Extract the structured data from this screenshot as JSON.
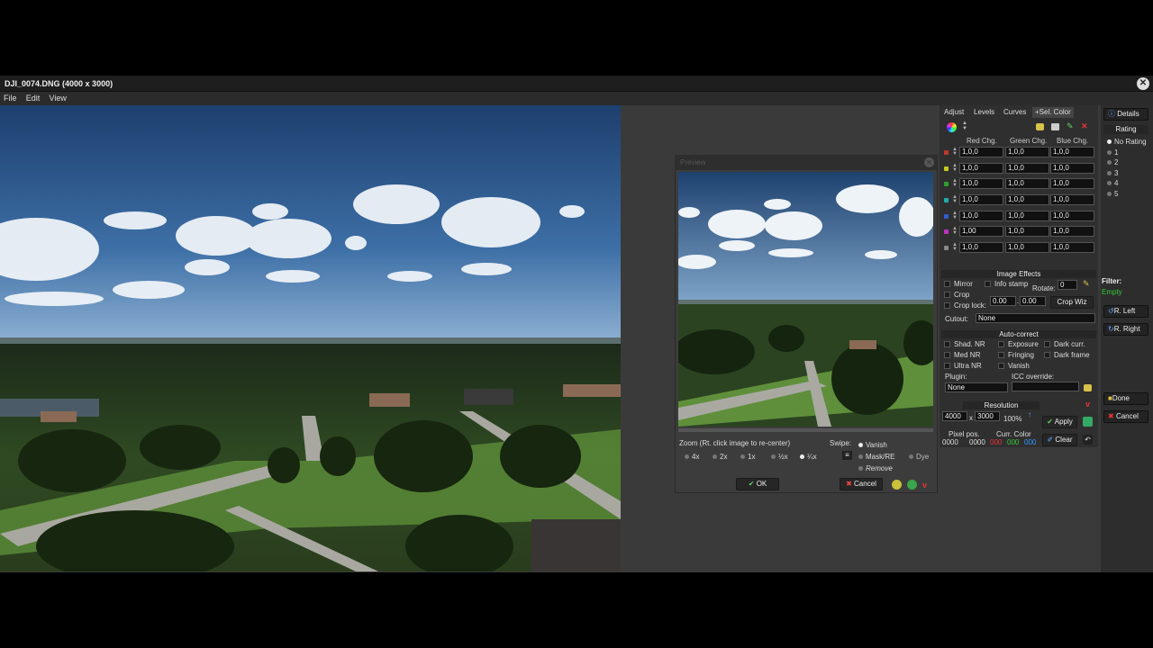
{
  "window": {
    "title": "DJI_0074.DNG (4000 x 3000)",
    "close_glyph": "✕"
  },
  "menu": [
    "File",
    "Edit",
    "View"
  ],
  "preview": {
    "title": "Preview",
    "zoom_label": "Zoom (Rt. click image to re-center)",
    "zoom_options": [
      "4x",
      "2x",
      "1x",
      "½x",
      "¼x"
    ],
    "swipe_label": "Swipe:",
    "swipe_options": [
      "Vanish",
      "Mask/RE",
      "Remove",
      "Dye"
    ],
    "ok": "OK",
    "cancel": "Cancel"
  },
  "tabs": [
    "Adjust",
    "Levels",
    "Curves",
    "+Sel. Color"
  ],
  "selcolor": {
    "headers": [
      "Red Chg.",
      "Green Chg.",
      "Blue Chg."
    ],
    "row_colors": [
      "#c0392b",
      "#c8c820",
      "#2ea02e",
      "#20b0b0",
      "#2f5fd0",
      "#c030c0",
      "#888888"
    ],
    "row_labels": [
      "R",
      "Y",
      "G",
      "C",
      "B",
      "M",
      "N"
    ],
    "rows": [
      [
        "1,0,0",
        "1,0,0",
        "1,0,0"
      ],
      [
        "1,0,0",
        "1,0,0",
        "1,0,0"
      ],
      [
        "1,0,0",
        "1,0,0",
        "1,0,0"
      ],
      [
        "1,0,0",
        "1,0,0",
        "1,0,0"
      ],
      [
        "1,0,0",
        "1,0,0",
        "1,0,0"
      ],
      [
        "1,00",
        "1,0,0",
        "1,0,0"
      ],
      [
        "1,0,0",
        "1,0,0",
        "1,0,0"
      ]
    ]
  },
  "image_effects": {
    "title": "Image Effects",
    "mirror": "Mirror",
    "info_stamp": "Info stamp",
    "rotate_label": "Rotate:",
    "rotate_value": "0",
    "crop": "Crop",
    "crop_lock": "Crop lock:",
    "crop_w": "0.00",
    "crop_h": "0.00",
    "crop_wiz": "Crop Wiz",
    "cutout_label": "Cutout:",
    "cutout_value": "None"
  },
  "auto_correct": {
    "title": "Auto-correct",
    "items": [
      "Shad. NR",
      "Exposure",
      "Dark curr.",
      "Med NR",
      "Fringing",
      "Dark frame",
      "Ultra NR",
      "Vanish"
    ],
    "plugin_label": "Plugin:",
    "plugin_value": "None",
    "icc_label": "ICC override:",
    "icc_value": ""
  },
  "resolution": {
    "title": "Resolution",
    "width": "4000",
    "x": "x",
    "height": "3000",
    "percent": "100%",
    "apply": "Apply",
    "clear": "Clear"
  },
  "pixel": {
    "pos_label": "Pixel pos.",
    "pos_x": "0000",
    "pos_y": "0000",
    "color_label": "Curr. Color",
    "r": "000",
    "g": "000",
    "b": "000"
  },
  "right": {
    "details": "Details",
    "rating_title": "Rating",
    "ratings": [
      "No Rating",
      "1",
      "2",
      "3",
      "4",
      "5"
    ],
    "filter_label": "Filter:",
    "filter_value": "Empty",
    "rot_left": "R. Left",
    "rot_right": "R. Right",
    "done": "Done",
    "cancel": "Cancel"
  }
}
